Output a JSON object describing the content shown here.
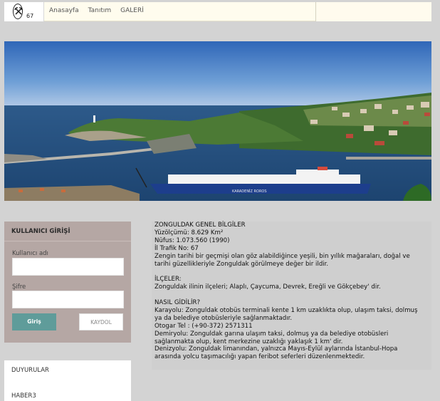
{
  "header": {
    "logo_number": "67",
    "nav": [
      "Anasayfa",
      "Tanıtım",
      "GALERİ"
    ]
  },
  "login": {
    "title": "KULLANICI GİRİŞİ",
    "username_label": "Kullanıcı adı",
    "username_value": "",
    "password_label": "Şifre",
    "password_value": "",
    "login_button": "Giriş",
    "register_button": "KAYDOL"
  },
  "sidebar": {
    "items": [
      "DUYURULAR",
      "HABER3"
    ]
  },
  "info": {
    "lines": [
      "ZONGULDAK GENEL BİLGİLER",
      "Yüzölçümü: 8.629 Km²",
      "Nüfus: 1.073.560 (1990)",
      "İl Trafik No: 67",
      "Zengin tarihi bir geçmişi olan göz alabildiğince yeşili, bin yıllık mağaraları, doğal ve",
      "tarihi güzellikleriyle Zonguldak görülmeye değer bir ildir.",
      "",
      "İLÇELER:",
      "Zonguldak ilinin ilçeleri; Alaplı, Çaycuma, Devrek, Ereğli ve Gökçebey' dir.",
      "",
      "NASIL GİDİLİR?",
      "Karayolu: Zonguldak otobüs terminali kente 1 km uzaklıkta olup, ulaşım taksi, dolmuş",
      "ya da belediye otobüsleriyle sağlanmaktadır.",
      "Otogar Tel : (+90-372) 2571311",
      "Demiryolu: Zonguldak garına ulaşım taksi, dolmuş ya da belediye otobüsleri",
      "sağlanmakta olup, kent merkezine uzaklığı yaklaşık 1 km' dir.",
      "Denizyolu: Zonguldak limanından, yalnızca Mayıs-Eylül aylarında İstanbul-Hopa",
      "arasında yolcu taşımacılığı yapan feribot seferleri düzenlenmektedir."
    ]
  },
  "hero": {
    "ship_name": "KARADENİZ ROROS"
  }
}
